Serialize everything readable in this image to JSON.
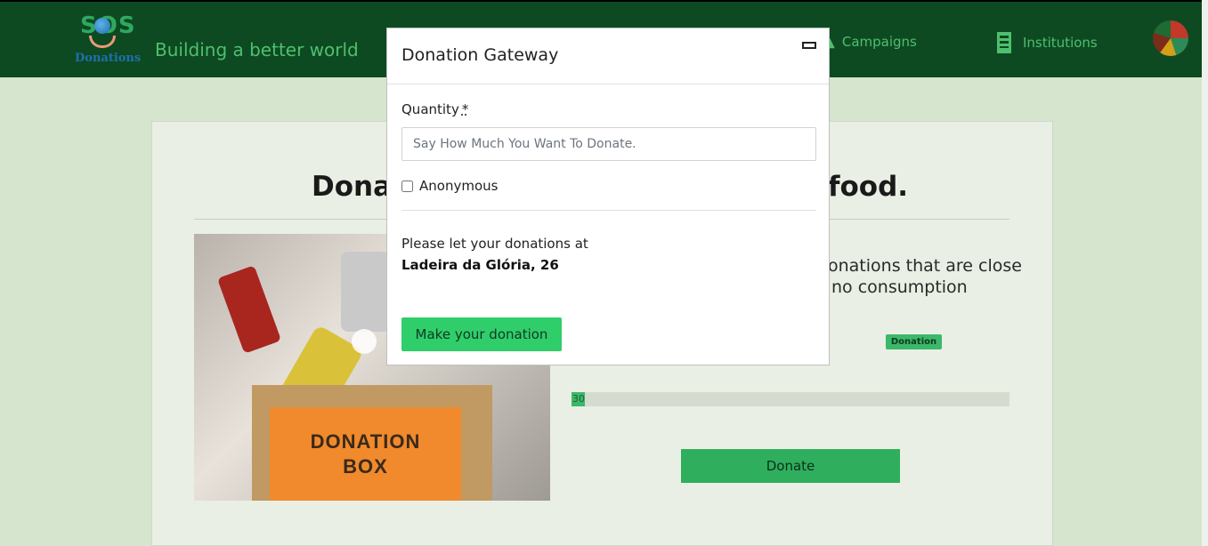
{
  "navbar": {
    "logo_top": "SOS",
    "logo_sub": "Donations",
    "tagline": "Building a better world",
    "campaigns_label": "Campaigns",
    "institutions_label": "Institutions"
  },
  "page": {
    "title_start": "Donat",
    "title_end": "food.",
    "description_line1": "onations that are close",
    "description_line2": "no consumption",
    "badge": "Donation",
    "progress_value": 30,
    "progress_label": "30",
    "donate_label": "Donate",
    "photo_text_line1": "DONATION",
    "photo_text_line2": "BOX"
  },
  "modal": {
    "title": "Donation Gateway",
    "quantity_label": "Quantity",
    "required_marker": "*",
    "quantity_placeholder": "Say How Much You Want To Donate.",
    "quantity_value": "",
    "anonymous_label": "Anonymous",
    "anonymous_checked": false,
    "info_text": "Please let your donations at",
    "address": "Ladeira da Glória, 26",
    "submit_label": "Make your donation"
  },
  "colors": {
    "navbar_bg": "#0d4a22",
    "accent_green": "#2fce6a",
    "nav_text": "#4fbf6f"
  },
  "icons": {
    "campaigns": "up-arrow-icon",
    "institutions": "building-icon",
    "close": "close-icon"
  }
}
